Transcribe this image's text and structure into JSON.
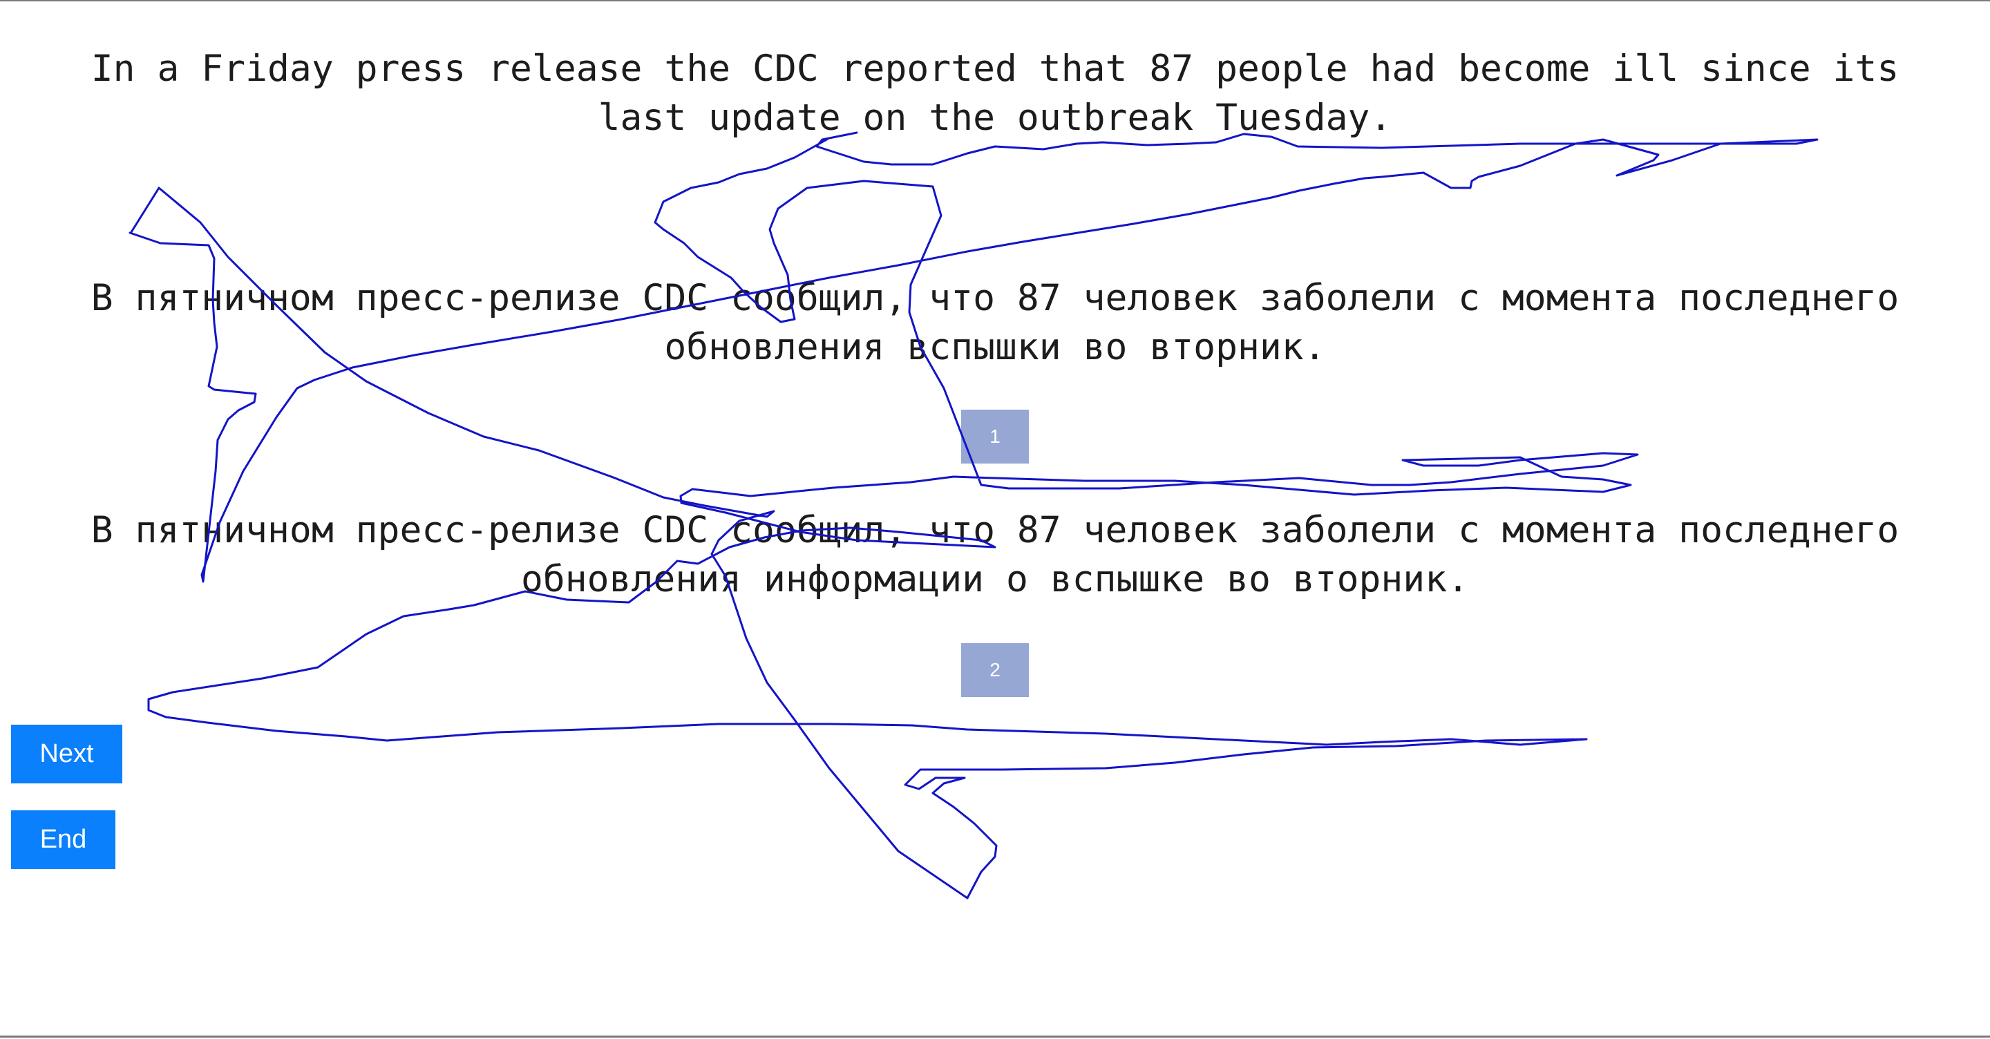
{
  "source_sentence": "In a Friday press release the CDC reported that 87 people had become ill since its last update on the outbreak Tuesday.",
  "translations": [
    {
      "text": "В пятничном пресс-релизе CDC сообщил, что 87 человек заболели с момента последнего обновления вспышки во вторник.",
      "badge": "1"
    },
    {
      "text": "В пятничном пресс-релизе CDC сообщил, что 87 человек заболели с момента последнего обновления информации о вспышке во вторник.",
      "badge": "2"
    }
  ],
  "buttons": {
    "next_label": "Next",
    "end_label": "End"
  },
  "colors": {
    "badge": "#95a7d2",
    "button": "#0a80fc",
    "scribble": "#1414c8"
  }
}
